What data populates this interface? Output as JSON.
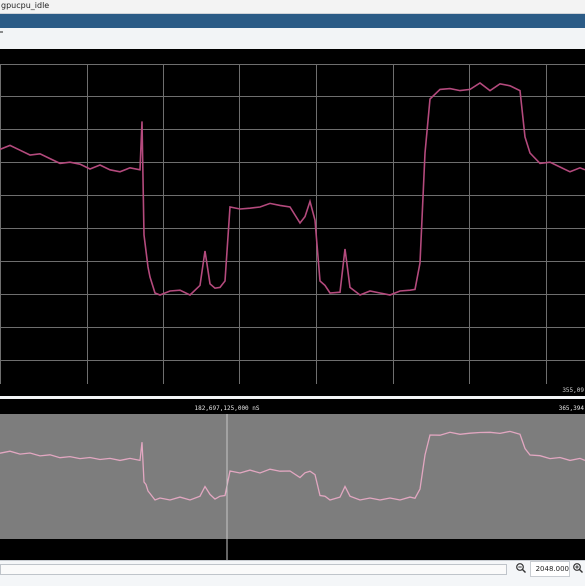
{
  "window": {
    "title": "gpucpu_idle"
  },
  "main_plot": {
    "right_label": "355,09",
    "trace_color": "#b44a7d",
    "grid_color": "#6e6e6e"
  },
  "overview": {
    "cursor_label": "182,697,125,000 nS",
    "right_label": "365,394",
    "trace_color": "#e2a7c1",
    "background": "#7d7d7d"
  },
  "status": {
    "zoom_value": "2048.000",
    "zoom_out_icon": "magnifier-minus-icon",
    "zoom_in_icon": "magnifier-plus-icon"
  },
  "chart_data": {
    "type": "line",
    "series": [
      {
        "x": [
          0,
          10,
          20,
          30,
          40,
          50,
          60,
          70,
          80,
          90,
          100,
          110,
          120,
          130,
          140,
          142,
          144,
          146,
          148,
          150,
          155,
          160,
          170,
          180,
          190,
          200,
          205,
          210,
          215,
          220,
          225,
          230,
          240,
          250,
          260,
          270,
          280,
          290,
          300,
          305,
          310,
          315,
          320,
          325,
          330,
          340,
          345,
          350,
          360,
          370,
          380,
          390,
          400,
          410,
          415,
          420,
          425,
          430,
          440,
          450,
          460,
          470,
          480,
          490,
          500,
          510,
          520,
          525,
          530,
          540,
          550,
          560,
          570,
          580,
          585
        ],
        "y": [
          0.72,
          0.72,
          0.71,
          0.7,
          0.69,
          0.68,
          0.67,
          0.66,
          0.66,
          0.65,
          0.65,
          0.64,
          0.64,
          0.64,
          0.64,
          0.82,
          0.4,
          0.35,
          0.3,
          0.25,
          0.2,
          0.2,
          0.2,
          0.21,
          0.2,
          0.22,
          0.35,
          0.24,
          0.21,
          0.22,
          0.25,
          0.5,
          0.5,
          0.51,
          0.5,
          0.52,
          0.52,
          0.5,
          0.45,
          0.48,
          0.52,
          0.46,
          0.25,
          0.22,
          0.2,
          0.21,
          0.35,
          0.22,
          0.2,
          0.2,
          0.2,
          0.2,
          0.2,
          0.21,
          0.22,
          0.3,
          0.7,
          0.9,
          0.92,
          0.93,
          0.93,
          0.92,
          0.95,
          0.93,
          0.94,
          0.94,
          0.93,
          0.75,
          0.7,
          0.67,
          0.66,
          0.65,
          0.64,
          0.64,
          0.64
        ],
        "color": "#b44a7d"
      }
    ],
    "ylim": [
      0,
      1
    ],
    "grid": true
  }
}
